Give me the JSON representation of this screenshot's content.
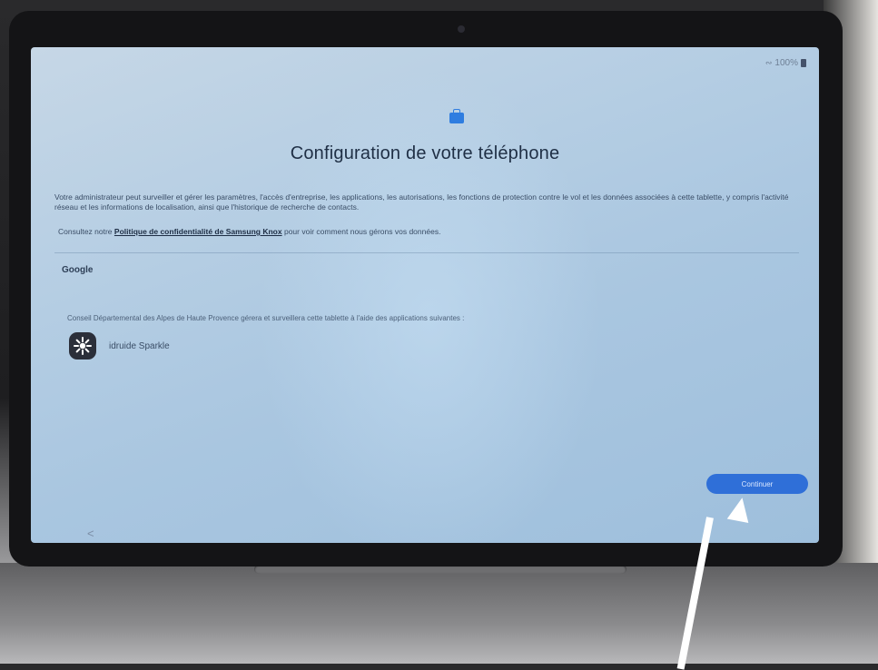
{
  "status_bar": {
    "battery": "100%"
  },
  "header": {
    "icon": "briefcase-icon",
    "title": "Configuration de votre téléphone"
  },
  "body": {
    "description": "Votre administrateur peut surveiller et gérer les paramètres, l'accès d'entreprise, les applications, les autorisations, les fonctions de protection contre le vol et les données associées à cette tablette, y compris l'activité réseau et les informations de localisation, ainsi que l'historique de recherche de contacts.",
    "privacy_prefix": "Consultez notre",
    "privacy_link": "Politique de confidentialité de Samsung Knox",
    "privacy_suffix": "pour voir comment nous gérons vos données."
  },
  "google_section": {
    "label": "Google"
  },
  "council_text": "Conseil Départemental des Alpes de Haute Provence gérera et surveillera cette tablette à l'aide des applications suivantes :",
  "apps": [
    {
      "name": "idruide Sparkle",
      "icon": "sparkle-icon"
    }
  ],
  "actions": {
    "continue_label": "Continuer",
    "back_label": "<"
  },
  "colors": {
    "accent": "#2f6fd8",
    "screen_bg": "#b4cde3",
    "title": "#1f2f45"
  }
}
